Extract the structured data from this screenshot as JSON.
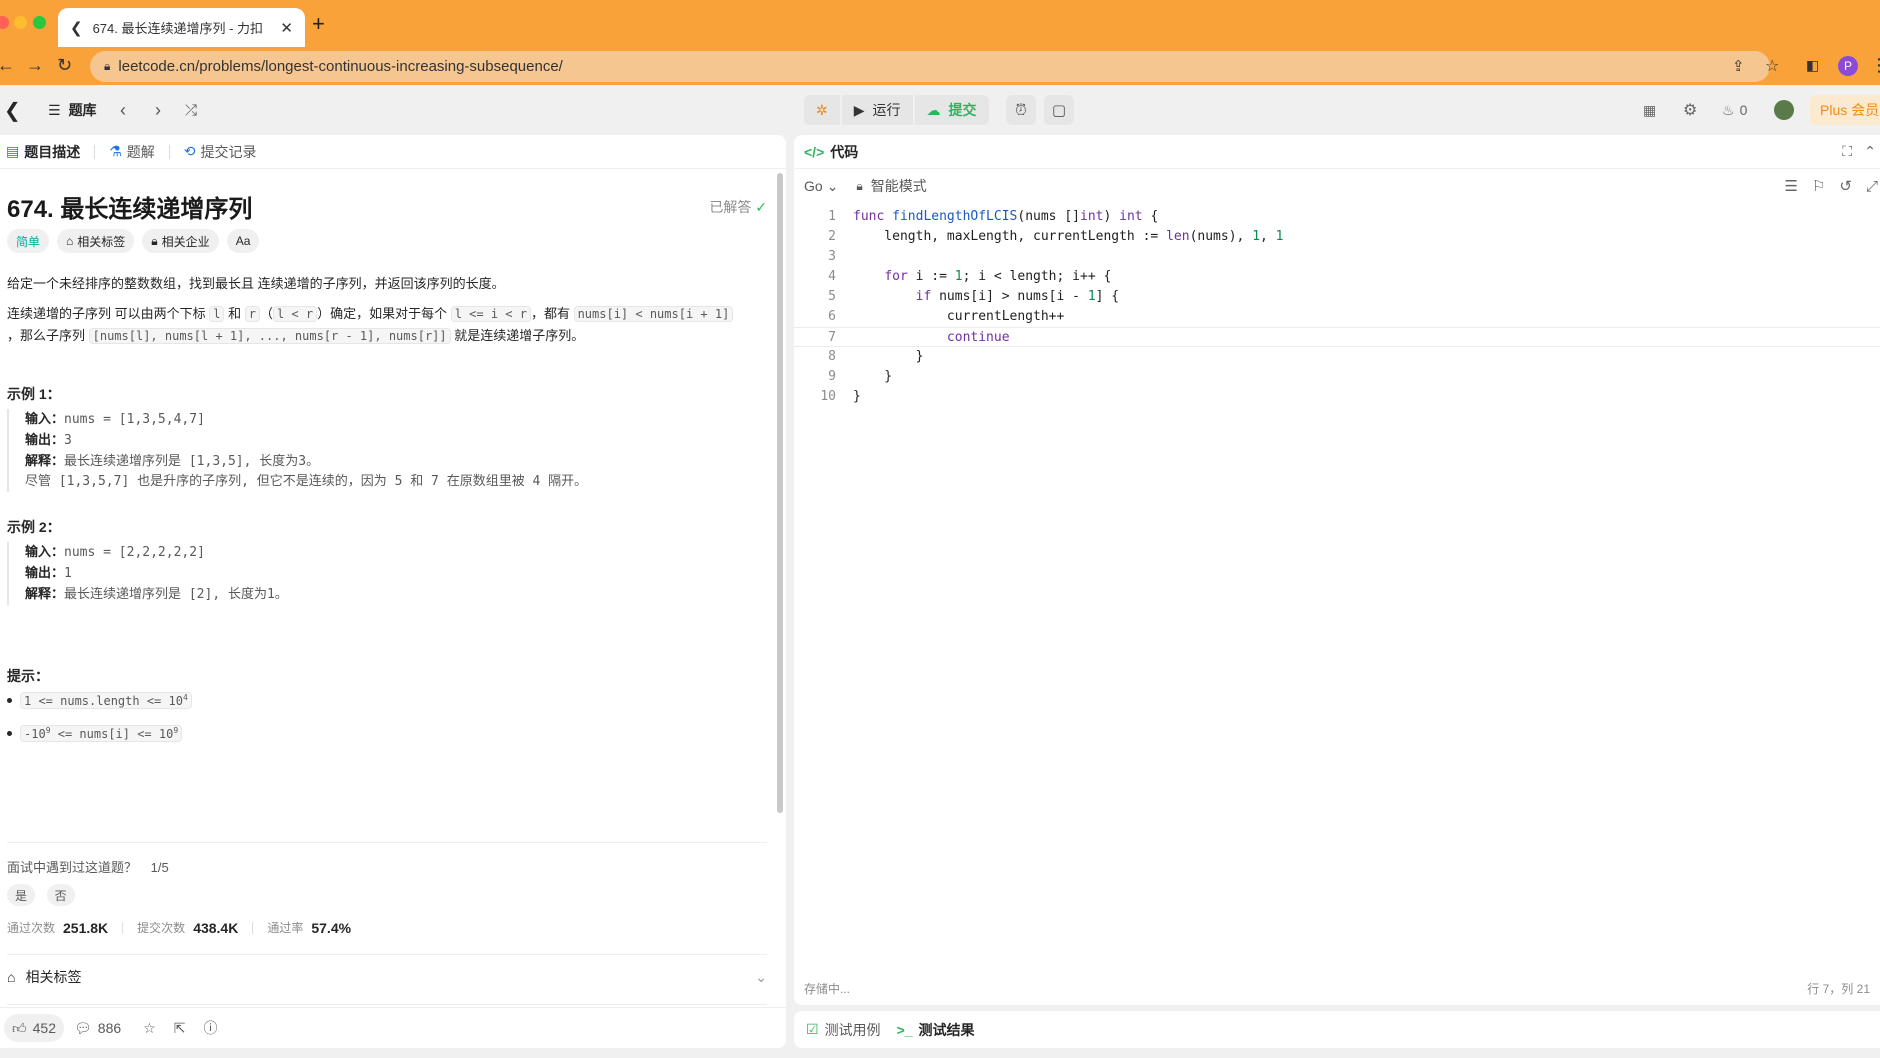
{
  "browser": {
    "tab_title": "674. 最长连续递增序列 - 力扣",
    "url": "leetcode.cn/problems/longest-continuous-increasing-subsequence/",
    "avatar_letter": "P"
  },
  "topbar": {
    "problem_list": "题库",
    "run_label": "运行",
    "submit_label": "提交",
    "fire_count": "0",
    "plus_label": "Plus 会员"
  },
  "left": {
    "tabs": [
      "题目描述",
      "题解",
      "提交记录"
    ],
    "title": "674. 最长连续递增序列",
    "solved": "已解答",
    "tags": [
      "简单",
      "相关标签",
      "相关企业",
      "Aa"
    ],
    "desc1": "给定一个未经排序的整数数组，找到最长且 连续递增的子序列，并返回该序列的长度。",
    "desc2_a": "连续递增的子序列 可以由两个下标 ",
    "desc2_l": "l",
    "desc2_b": " 和 ",
    "desc2_r": "r",
    "desc2_c": "（",
    "desc2_lr": "l < r",
    "desc2_d": "）确定，如果对于每个 ",
    "desc2_cond": "l <= i < r",
    "desc2_e": "，都有 ",
    "desc2_ineq": "nums[i] < nums[i + 1]",
    "desc3_a": "，那么子序列 ",
    "desc3_seq": "[nums[l], nums[l + 1], ..., nums[r - 1], nums[r]]",
    "desc3_b": " 就是连续递增子序列。",
    "example1_title": "示例 1：",
    "example1": {
      "in_label": "输入：",
      "in": "nums = [1,3,5,4,7]",
      "out_label": "输出：",
      "out": "3",
      "exp_label": "解释：",
      "exp": "最长连续递增序列是 [1,3,5], 长度为3。",
      "exp2": "尽管 [1,3,5,7] 也是升序的子序列, 但它不是连续的，因为 5 和 7 在原数组里被 4 隔开。"
    },
    "example2_title": "示例 2：",
    "example2": {
      "in_label": "输入：",
      "in": "nums = [2,2,2,2,2]",
      "out_label": "输出：",
      "out": "1",
      "exp_label": "解释：",
      "exp": "最长连续递增序列是 [2], 长度为1。"
    },
    "hints_title": "提示：",
    "hint1_a": "1 <= nums.length <= 10",
    "hint1_sup": "4",
    "hint2_a": "-10",
    "hint2_sup1": "9",
    "hint2_b": " <= nums[i] <= 10",
    "hint2_sup2": "9",
    "interview_q": "面试中遇到过这道题？",
    "interview_count": "1/5",
    "yes": "是",
    "no": "否",
    "stats": {
      "accepted_label": "通过次数",
      "accepted": "251.8K",
      "submitted_label": "提交次数",
      "submitted": "438.4K",
      "rate_label": "通过率",
      "rate": "57.4%"
    },
    "related_tags": "相关标签",
    "likes": "452",
    "comments": "886"
  },
  "editor": {
    "header": "代码",
    "language": "Go",
    "mode": "智能模式",
    "saving": "存储中...",
    "cursor_pos": "行 7，列 21",
    "lines": [
      "func findLengthOfLCIS(nums []int) int {",
      "    length, maxLength, currentLength := len(nums), 1, 1",
      "",
      "    for i := 1; i < length; i++ {",
      "        if nums[i] > nums[i - 1] {",
      "            currentLength++",
      "            continue",
      "        }",
      "    }",
      "}"
    ]
  },
  "bottom": {
    "testcase": "测试用例",
    "result": "测试结果"
  }
}
